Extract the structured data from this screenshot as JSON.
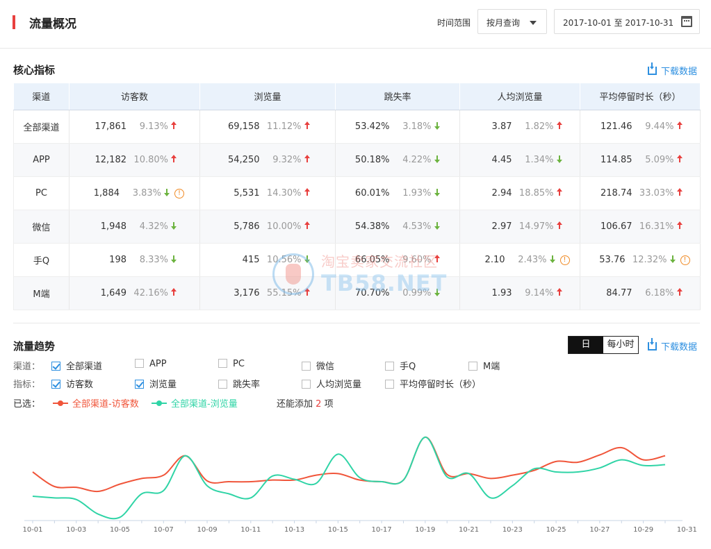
{
  "header": {
    "title": "流量概况",
    "range_label": "时间范围",
    "query_select": "按月查询",
    "date_start": "2017-10-01",
    "date_sep": "至",
    "date_end": "2017-10-31"
  },
  "core": {
    "title": "核心指标",
    "download": "下载数据",
    "columns": [
      "渠道",
      "访客数",
      "浏览量",
      "跳失率",
      "人均浏览量",
      "平均停留时长（秒）"
    ],
    "rows": [
      {
        "channel": "全部渠道",
        "cells": [
          {
            "v": "17,861",
            "p": "9.13%",
            "d": "up",
            "w": false
          },
          {
            "v": "69,158",
            "p": "11.12%",
            "d": "up",
            "w": false
          },
          {
            "v": "53.42%",
            "p": "3.18%",
            "d": "down",
            "w": false
          },
          {
            "v": "3.87",
            "p": "1.82%",
            "d": "up",
            "w": false
          },
          {
            "v": "121.46",
            "p": "9.44%",
            "d": "up",
            "w": false
          }
        ]
      },
      {
        "channel": "APP",
        "cells": [
          {
            "v": "12,182",
            "p": "10.80%",
            "d": "up",
            "w": false
          },
          {
            "v": "54,250",
            "p": "9.32%",
            "d": "up",
            "w": false
          },
          {
            "v": "50.18%",
            "p": "4.22%",
            "d": "down",
            "w": false
          },
          {
            "v": "4.45",
            "p": "1.34%",
            "d": "down",
            "w": false
          },
          {
            "v": "114.85",
            "p": "5.09%",
            "d": "up",
            "w": false
          }
        ]
      },
      {
        "channel": "PC",
        "cells": [
          {
            "v": "1,884",
            "p": "3.83%",
            "d": "down",
            "w": true
          },
          {
            "v": "5,531",
            "p": "14.30%",
            "d": "up",
            "w": false
          },
          {
            "v": "60.01%",
            "p": "1.93%",
            "d": "down",
            "w": false
          },
          {
            "v": "2.94",
            "p": "18.85%",
            "d": "up",
            "w": false
          },
          {
            "v": "218.74",
            "p": "33.03%",
            "d": "up",
            "w": false
          }
        ]
      },
      {
        "channel": "微信",
        "cells": [
          {
            "v": "1,948",
            "p": "4.32%",
            "d": "down",
            "w": false
          },
          {
            "v": "5,786",
            "p": "10.00%",
            "d": "up",
            "w": false
          },
          {
            "v": "54.38%",
            "p": "4.53%",
            "d": "down",
            "w": false
          },
          {
            "v": "2.97",
            "p": "14.97%",
            "d": "up",
            "w": false
          },
          {
            "v": "106.67",
            "p": "16.31%",
            "d": "up",
            "w": false
          }
        ]
      },
      {
        "channel": "手Q",
        "cells": [
          {
            "v": "198",
            "p": "8.33%",
            "d": "down",
            "w": false
          },
          {
            "v": "415",
            "p": "10.56%",
            "d": "down",
            "w": false
          },
          {
            "v": "66.05%",
            "p": "9.60%",
            "d": "up",
            "w": false
          },
          {
            "v": "2.10",
            "p": "2.43%",
            "d": "down",
            "w": true
          },
          {
            "v": "53.76",
            "p": "12.32%",
            "d": "down",
            "w": true
          }
        ]
      },
      {
        "channel": "M端",
        "cells": [
          {
            "v": "1,649",
            "p": "42.16%",
            "d": "up",
            "w": false
          },
          {
            "v": "3,176",
            "p": "55.15%",
            "d": "up",
            "w": false
          },
          {
            "v": "70.70%",
            "p": "0.99%",
            "d": "down",
            "w": false
          },
          {
            "v": "1.93",
            "p": "9.14%",
            "d": "up",
            "w": false
          },
          {
            "v": "84.77",
            "p": "6.18%",
            "d": "up",
            "w": false
          }
        ]
      }
    ]
  },
  "trend": {
    "title": "流量趋势",
    "download": "下载数据",
    "toggle_day": "日",
    "toggle_hour": "每小时",
    "channel_label": "渠道：",
    "metric_label": "指标：",
    "channels": [
      {
        "label": "全部渠道",
        "checked": true
      },
      {
        "label": "APP",
        "checked": false
      },
      {
        "label": "PC",
        "checked": false
      },
      {
        "label": "微信",
        "checked": false
      },
      {
        "label": "手Q",
        "checked": false
      },
      {
        "label": "M端",
        "checked": false
      }
    ],
    "metrics": [
      {
        "label": "访客数",
        "checked": true
      },
      {
        "label": "浏览量",
        "checked": true
      },
      {
        "label": "跳失率",
        "checked": false
      },
      {
        "label": "人均浏览量",
        "checked": false
      },
      {
        "label": "平均停留时长（秒）",
        "checked": false
      }
    ],
    "selected_label": "已选：",
    "selected": [
      {
        "label": "全部渠道-访客数",
        "color": "#f0553a"
      },
      {
        "label": "全部渠道-浏览量",
        "color": "#2fd4a6"
      }
    ],
    "more_prefix": "还能添加",
    "more_num": "2",
    "more_suffix": "项"
  },
  "watermark": {
    "cn": "淘宝卖家交流社区",
    "en": "TB58.NET"
  },
  "chart_data": {
    "type": "line",
    "x": [
      "10-01",
      "10-02",
      "10-03",
      "10-04",
      "10-05",
      "10-06",
      "10-07",
      "10-08",
      "10-09",
      "10-10",
      "10-11",
      "10-12",
      "10-13",
      "10-14",
      "10-15",
      "10-16",
      "10-17",
      "10-18",
      "10-19",
      "10-20",
      "10-21",
      "10-22",
      "10-23",
      "10-24",
      "10-25",
      "10-26",
      "10-27",
      "10-28",
      "10-29",
      "10-30",
      "10-31"
    ],
    "xticks": [
      "10-01",
      "10-03",
      "10-05",
      "10-07",
      "10-09",
      "10-11",
      "10-13",
      "10-15",
      "10-17",
      "10-19",
      "10-21",
      "10-23",
      "10-25",
      "10-27",
      "10-29",
      "10-31"
    ],
    "series": [
      {
        "name": "全部渠道-访客数",
        "color": "#f0553a",
        "values": [
          60,
          42,
          41,
          36,
          45,
          52,
          56,
          80,
          49,
          48,
          48,
          50,
          50,
          56,
          58,
          50,
          48,
          50,
          103,
          57,
          58,
          52,
          56,
          62,
          73,
          72,
          81,
          90,
          75,
          80,
          0
        ]
      },
      {
        "name": "全部渠道-浏览量",
        "color": "#2fd4a6",
        "values": [
          30,
          28,
          26,
          8,
          4,
          33,
          37,
          80,
          43,
          33,
          28,
          55,
          51,
          46,
          82,
          53,
          48,
          50,
          103,
          54,
          58,
          28,
          43,
          64,
          60,
          60,
          65,
          75,
          68,
          69,
          0
        ]
      }
    ],
    "ylim": [
      0,
      120
    ]
  }
}
